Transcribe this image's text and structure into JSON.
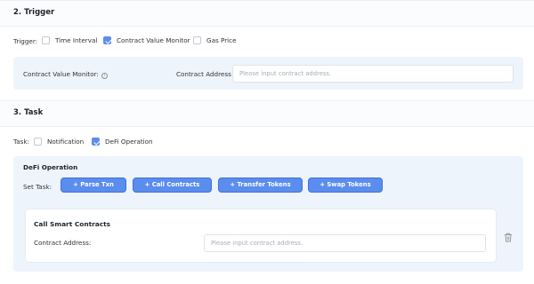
{
  "trigger_section": {
    "title": "2. Trigger",
    "label": "Trigger:",
    "options": [
      {
        "label": "Time Interval",
        "checked": false
      },
      {
        "label": "Contract Value Monitor",
        "checked": true
      },
      {
        "label": "Gas Price",
        "checked": false
      }
    ],
    "monitor": {
      "label": "Contract Value Monitor:",
      "info_icon": "info-circle-icon",
      "address_label": "Contract Address",
      "address_placeholder": "Please input contract address."
    }
  },
  "task_section": {
    "title": "3. Task",
    "label": "Task:",
    "options": [
      {
        "label": "Notification",
        "checked": false
      },
      {
        "label": "DeFi Operation",
        "checked": true
      }
    ],
    "defi": {
      "title": "DeFi Operation",
      "set_task_label": "Set Task:",
      "buttons": [
        "+ Parse Txn",
        "+ Call Contracts",
        "+ Transfer Tokens",
        "+ Swap Tokens"
      ],
      "card": {
        "title": "Call Smart Contracts",
        "address_label": "Contract Address:",
        "address_placeholder": "Please input contract address.",
        "delete_icon": "trash-icon"
      }
    }
  },
  "colors": {
    "accent": "#5b8def",
    "panel_bg": "#eef4fc"
  }
}
